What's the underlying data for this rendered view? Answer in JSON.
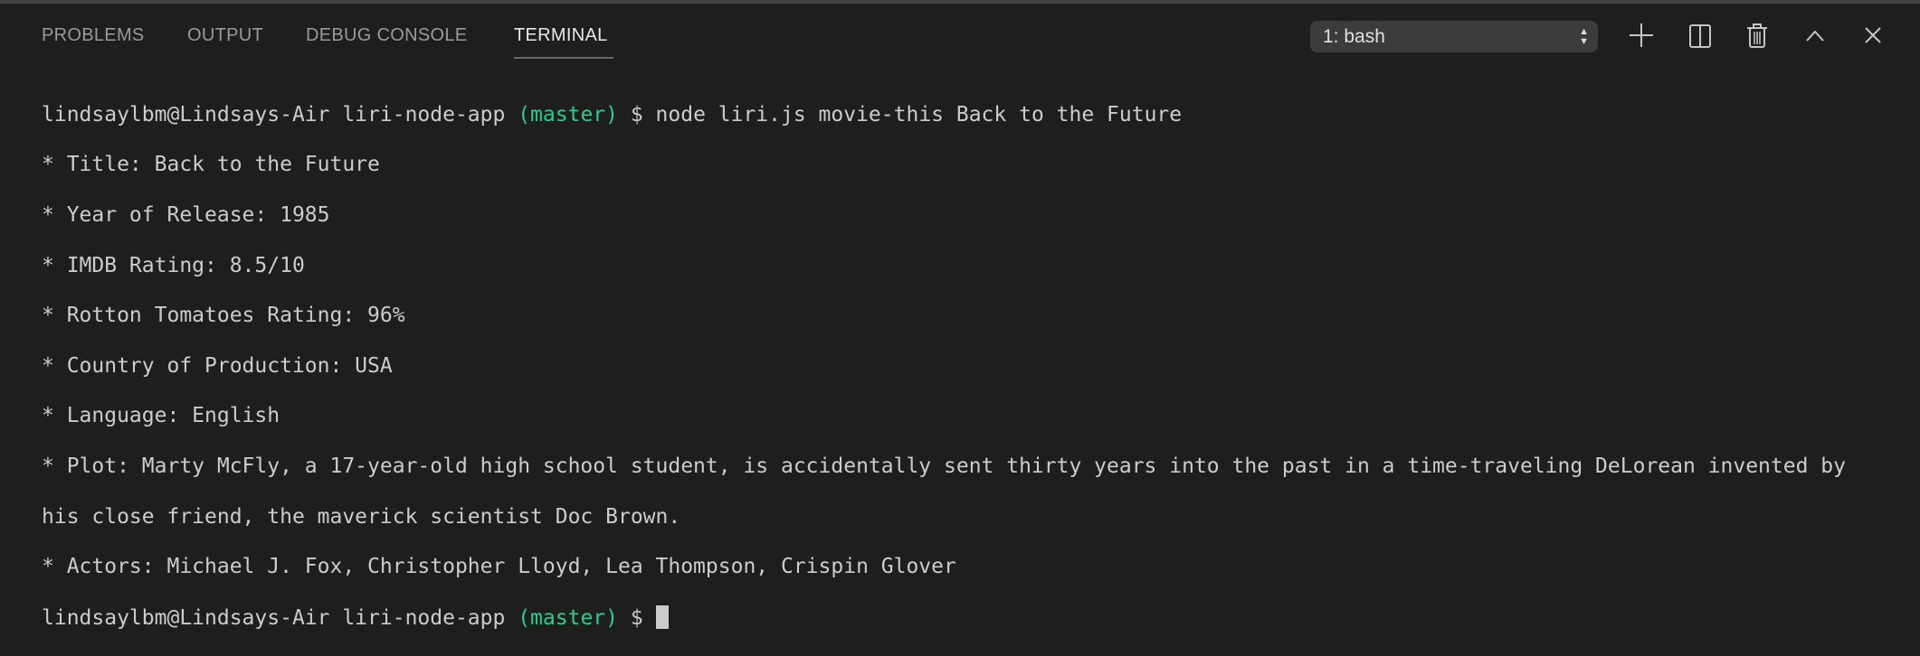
{
  "tabs": [
    {
      "label": "PROBLEMS"
    },
    {
      "label": "OUTPUT"
    },
    {
      "label": "DEBUG CONSOLE"
    },
    {
      "label": "TERMINAL",
      "active": true
    }
  ],
  "terminal_selector": {
    "value": "1: bash"
  },
  "toolbar_icons": [
    "plus-icon",
    "split-icon",
    "trash-icon",
    "chevron-up-icon",
    "close-icon"
  ],
  "terminal": {
    "prompt_user": "lindsaylbm@Lindsays-Air liri-node-app ",
    "prompt_branch": "(master)",
    "prompt_symbol": " $ ",
    "command": "node liri.js movie-this Back to the Future",
    "output": [
      "* Title: Back to the Future",
      "* Year of Release: 1985",
      "* IMDB Rating: 8.5/10",
      "* Rotton Tomatoes Rating: 96%",
      "* Country of Production: USA",
      "* Language: English",
      "* Plot: Marty McFly, a 17-year-old high school student, is accidentally sent thirty years into the past in a time-traveling DeLorean invented by",
      "his close friend, the maverick scientist Doc Brown.",
      "* Actors: Michael J. Fox, Christopher Lloyd, Lea Thompson, Crispin Glover"
    ]
  },
  "colors": {
    "background": "#1e1e1e",
    "branch": "#23d18b",
    "text": "#cccccc"
  }
}
